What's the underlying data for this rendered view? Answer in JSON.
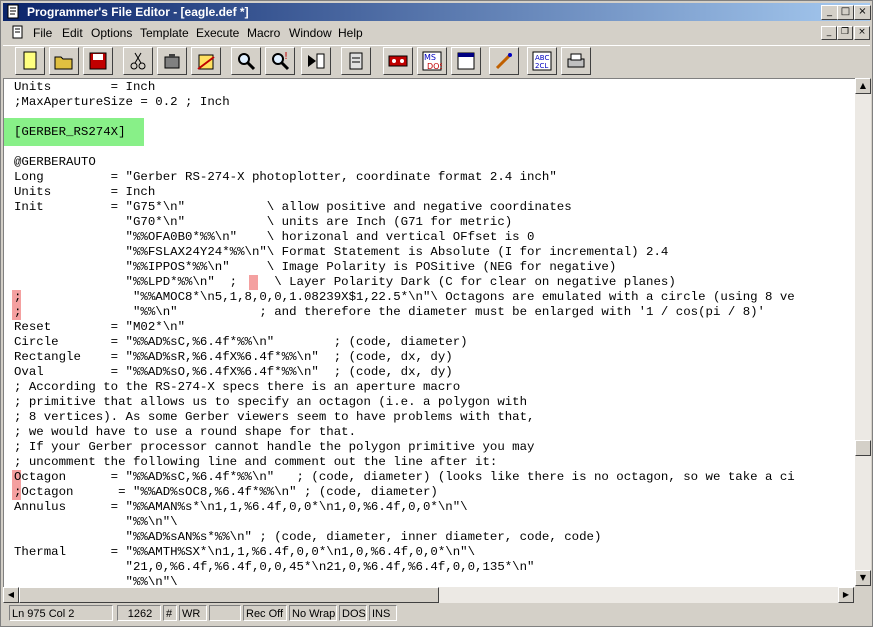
{
  "window": {
    "title": "Programmer's File Editor - [eagle.def *]"
  },
  "menu": [
    {
      "label": "File"
    },
    {
      "label": "Edit"
    },
    {
      "label": "Options"
    },
    {
      "label": "Template"
    },
    {
      "label": "Execute"
    },
    {
      "label": "Macro"
    },
    {
      "label": "Window"
    },
    {
      "label": "Help"
    }
  ],
  "toolbar": [
    {
      "icon": "new-file-icon"
    },
    {
      "icon": "open-folder-icon"
    },
    {
      "icon": "save-disk-icon"
    },
    {
      "icon": "cut-scissors-icon"
    },
    {
      "icon": "copy-icon"
    },
    {
      "icon": "paste-icon"
    },
    {
      "icon": "find-icon"
    },
    {
      "icon": "find-next-icon"
    },
    {
      "icon": "replace-icon"
    },
    {
      "icon": "template-icon"
    },
    {
      "icon": "record-macro-icon"
    },
    {
      "icon": "msdos-icon"
    },
    {
      "icon": "window-icon"
    },
    {
      "icon": "options-tools-icon"
    },
    {
      "icon": "abc-help-icon"
    },
    {
      "icon": "print-icon"
    }
  ],
  "editor": {
    "lines": [
      "Units        = Inch",
      ";MaxApertureSize = 0.2 ; Inch",
      "",
      "[GERBER_RS274X]",
      "",
      "@GERBERAUTO",
      "Long         = \"Gerber RS-274-X photoplotter, coordinate format 2.4 inch\"",
      "Units        = Inch",
      "Init         = \"G75*\\n\"           \\ allow positive and negative coordinates",
      "               \"G70*\\n\"           \\ units are Inch (G71 for metric)",
      "               \"%%OFA0B0*%%\\n\"    \\ horizonal and vertical OFfset is 0",
      "               \"%%FSLAX24Y24*%%\\n\"\\ Format Statement is Absolute (I for incremental) 2.4",
      "               \"%%IPPOS*%%\\n\"     \\ Image Polarity is POSitive (NEG for negative)",
      "               \"%%LPD*%%\\n\"  ;     \\ Layer Polarity Dark (C for clear on negative planes)",
      ";               \"%%AMOC8*\\n5,1,8,0,0,1.08239X$1,22.5*\\n\"\\ Octagons are emulated with a circle (using 8 ve",
      ";               \"%%\\n\"           ; and therefore the diameter must be enlarged with '1 / cos(pi / 8)'",
      "Reset        = \"M02*\\n\"",
      "Circle       = \"%%AD%sC,%6.4f*%%\\n\"        ; (code, diameter)",
      "Rectangle    = \"%%AD%sR,%6.4fX%6.4f*%%\\n\"  ; (code, dx, dy)",
      "Oval         = \"%%AD%sO,%6.4fX%6.4f*%%\\n\"  ; (code, dx, dy)",
      "; According to the RS-274-X specs there is an aperture macro",
      "; primitive that allows us to specify an octagon (i.e. a polygon with",
      "; 8 vertices). As some Gerber viewers seem to have problems with that,",
      "; we would have to use a round shape for that.",
      "; If your Gerber processor cannot handle the polygon primitive you may",
      "; uncomment the following line and comment out the line after it:",
      "Octagon      = \"%%AD%sC,%6.4f*%%\\n\"   ; (code, diameter) (looks like there is no octagon, so we take a ci",
      ";Octagon      = \"%%AD%sOC8,%6.4f*%%\\n\" ; (code, diameter)",
      "Annulus      = \"%%AMAN%s*\\n1,1,%6.4f,0,0*\\n1,0,%6.4f,0,0*\\n\"\\",
      "               \"%%\\n\"\\",
      "               \"%%AD%sAN%s*%%\\n\" ; (code, diameter, inner diameter, code, code)",
      "Thermal      = \"%%AMTH%SX*\\n1,1,%6.4f,0,0*\\n1,0,%6.4f,0,0*\\n\"\\",
      "               \"21,0,%6.4f,%6.4f,0,0,45*\\n21,0,%6.4f,%6.4f,0,0,135*\\n\"",
      "               \"%%\\n\"\\"
    ]
  },
  "status": {
    "position": "Ln 975 Col 2",
    "count": "1262",
    "hash": "#",
    "wr": "WR",
    "blank": "",
    "rec": "Rec Off",
    "wrap": "No Wrap",
    "mode": "DOS",
    "ins": "INS"
  },
  "colors": {
    "selection": "#88f088",
    "marker": "#f4a0a0",
    "titlebar": "#0a246a"
  }
}
